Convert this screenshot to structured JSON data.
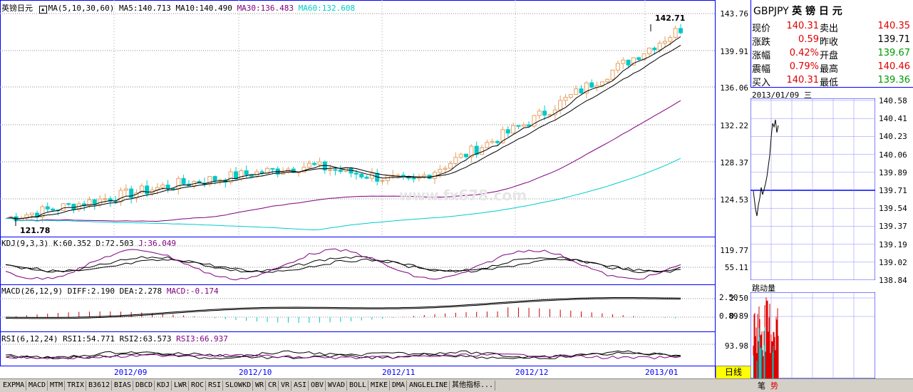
{
  "main_chart": {
    "title": "英镑日元",
    "ma_label": "MA(5,10,30,60)",
    "ma5": "MA5:140.713",
    "ma10": "MA10:140.490",
    "ma30": "MA30:136.483",
    "ma60": "MA60:132.608",
    "high_mark": "142.71",
    "low_mark": "121.78",
    "y_labels": [
      "143.76",
      "139.91",
      "136.06",
      "132.22",
      "128.37",
      "124.53"
    ],
    "watermark": "www.fx678.com"
  },
  "kdj_panel": {
    "title": "KDJ(9,3,3)",
    "k": "K:60.352",
    "d": "D:72.503",
    "j": "J:36.049",
    "y_labels": [
      "119.77",
      "55.11"
    ]
  },
  "macd_panel": {
    "title": "MACD(26,12,9)",
    "diff": "DIFF:2.190",
    "dea": "DEA:2.278",
    "macd": "MACD:-0.174",
    "y_labels": [
      "2.50",
      "0.89"
    ]
  },
  "rsi_panel": {
    "title": "RSI(6,12,24)",
    "rsi1": "RSI1:54.771",
    "rsi2": "RSI2:63.573",
    "rsi3": "RSI3:66.937",
    "y_labels": [
      "93.98"
    ]
  },
  "date_axis": [
    "2012/09",
    "2012/10",
    "2012/11",
    "2012/12",
    "2013/01"
  ],
  "period_button": "日线",
  "quote": {
    "symbol": "GBPJPY",
    "name": "英 镑 日 元",
    "rows": [
      {
        "l1": "现价",
        "v1": "140.31",
        "l2": "卖出",
        "v2": "140.35",
        "c1": "red",
        "c2": "red"
      },
      {
        "l1": "涨跌",
        "v1": "0.59",
        "l2": "昨收",
        "v2": "139.71",
        "c1": "red",
        "c2": "blk"
      },
      {
        "l1": "涨幅",
        "v1": "0.42%",
        "l2": "开盘",
        "v2": "139.67",
        "c1": "red",
        "c2": "green"
      },
      {
        "l1": "震幅",
        "v1": "0.79%",
        "l2": "最高",
        "v2": "140.46",
        "c1": "red",
        "c2": "red"
      },
      {
        "l1": "买入",
        "v1": "140.31",
        "l2": "最低",
        "v2": "139.36",
        "c1": "red",
        "c2": "green"
      }
    ]
  },
  "intraday": {
    "date": "2013/01/09 三",
    "y_labels": [
      "140.58",
      "140.41",
      "140.23",
      "140.06",
      "139.89",
      "139.71",
      "139.54",
      "139.37",
      "139.19",
      "139.02",
      "138.84"
    ],
    "tick_title": "跳动量",
    "tick_y_labels": [
      "2.50",
      "0.89"
    ],
    "footer_tabs": [
      "笔",
      "势"
    ]
  },
  "indicator_tabs": [
    "EXPMA",
    "MACD",
    "MTM",
    "TRIX",
    "B3612",
    "BIAS",
    "DBCD",
    "KDJ",
    "LWR",
    "ROC",
    "RSI",
    "SLOWKD",
    "WR",
    "CR",
    "VR",
    "ASI",
    "OBV",
    "WVAD",
    "BOLL",
    "MIKE",
    "DMA",
    "ANGLELINE",
    "其他指标..."
  ],
  "colors": {
    "up": "#e8a060",
    "down": "#00c8c8",
    "ma5": "#000000",
    "ma10": "#000000",
    "ma30": "#800080",
    "ma60": "#00cccc",
    "grid": "#0000ff"
  }
}
